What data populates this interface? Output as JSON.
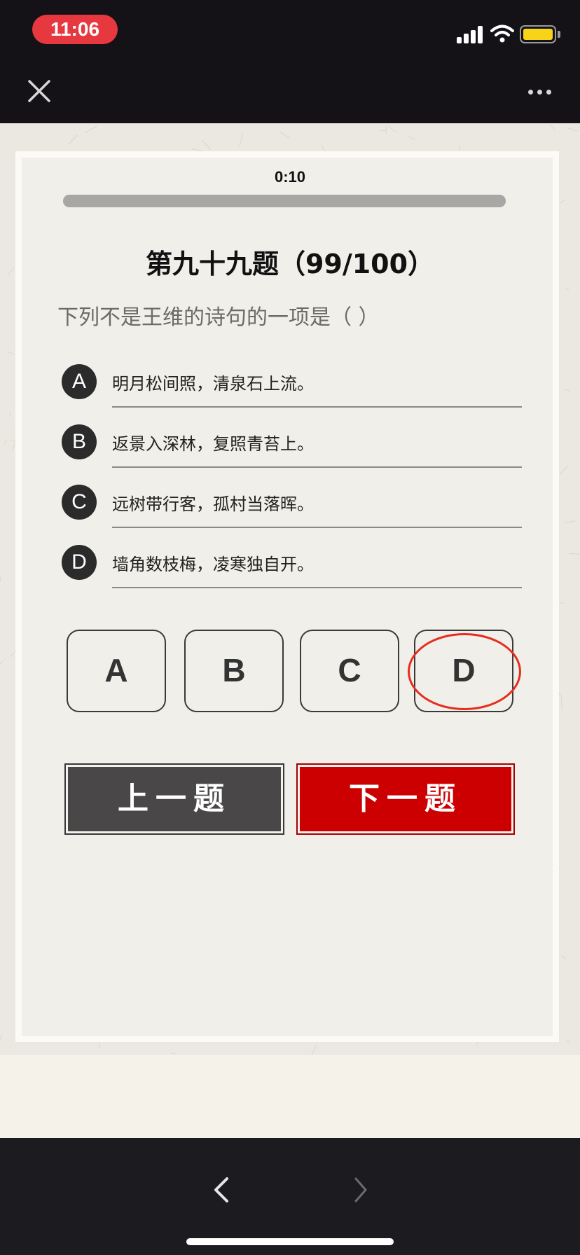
{
  "status_bar": {
    "time": "11:06",
    "signal_icon": "cellular-signal-icon",
    "wifi_icon": "wifi-icon",
    "battery_icon": "battery-icon",
    "battery_color": "#f7d417",
    "time_pill_color": "#e8383f"
  },
  "nav": {
    "close_icon": "close-icon",
    "more_icon": "more-dots-icon"
  },
  "quiz": {
    "timer": "0:10",
    "progress_fraction": 1.0,
    "title": "第九十九题（99/100）",
    "question": "下列不是王维的诗句的一项是（ ）",
    "options": [
      {
        "letter": "A",
        "text": "明月松间照，清泉石上流。"
      },
      {
        "letter": "B",
        "text": "返景入深林，复照青苔上。"
      },
      {
        "letter": "C",
        "text": "远树带行客，孤村当落晖。"
      },
      {
        "letter": "D",
        "text": "墙角数枝梅，凌寒独自开。"
      }
    ],
    "answers": [
      "A",
      "B",
      "C",
      "D"
    ],
    "selected_answer": "D",
    "selected_ring_color": "#e62d1f",
    "prev_label": "上一题",
    "next_label": "下一题",
    "prev_color": "#4a4749",
    "next_color": "#cc0000"
  },
  "toolbar": {
    "back_icon": "chevron-left-icon",
    "forward_icon": "chevron-right-icon"
  }
}
